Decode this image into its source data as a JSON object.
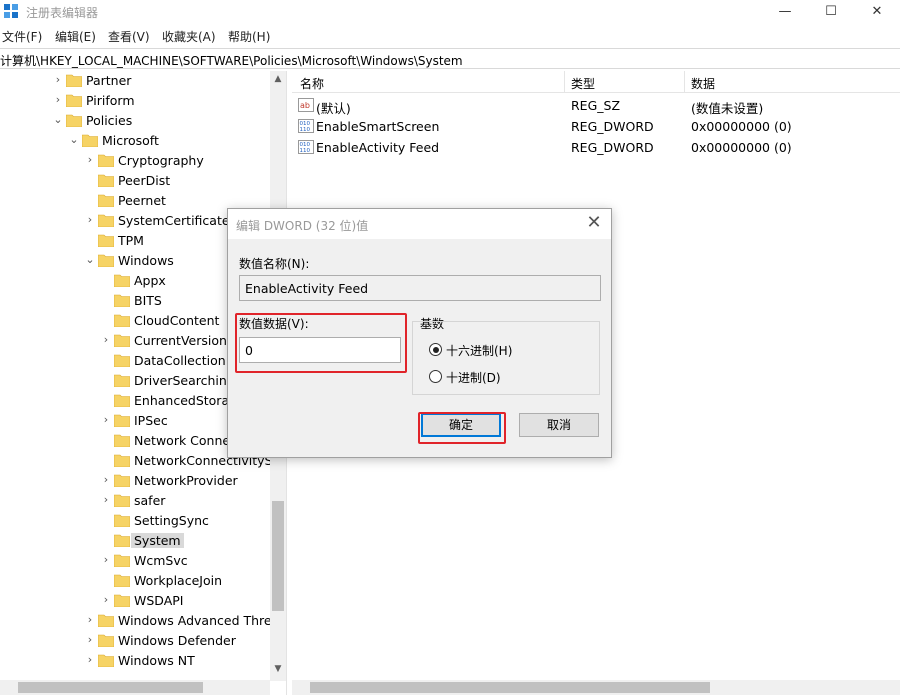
{
  "window": {
    "title": "注册表编辑器",
    "controls": {
      "minimize": "—",
      "maximize": "☐",
      "close": "✕"
    }
  },
  "menu": [
    "文件(F)",
    "编辑(E)",
    "查看(V)",
    "收藏夹(A)",
    "帮助(H)"
  ],
  "address": "计算机\\HKEY_LOCAL_MACHINE\\SOFTWARE\\Policies\\Microsoft\\Windows\\System",
  "tree": {
    "items": [
      {
        "label": "Partner",
        "expander": "›"
      },
      {
        "label": "Piriform",
        "expander": "›"
      },
      {
        "label": "Policies",
        "expander": "⌄"
      },
      {
        "label": "Microsoft",
        "expander": "⌄"
      },
      {
        "label": "Cryptography",
        "expander": "›"
      },
      {
        "label": "PeerDist",
        "expander": ""
      },
      {
        "label": "Peernet",
        "expander": ""
      },
      {
        "label": "SystemCertificates",
        "expander": "›"
      },
      {
        "label": "TPM",
        "expander": ""
      },
      {
        "label": "Windows",
        "expander": "⌄"
      },
      {
        "label": "Appx",
        "expander": ""
      },
      {
        "label": "BITS",
        "expander": ""
      },
      {
        "label": "CloudContent",
        "expander": ""
      },
      {
        "label": "CurrentVersion",
        "expander": "›"
      },
      {
        "label": "DataCollection",
        "expander": ""
      },
      {
        "label": "DriverSearching",
        "expander": ""
      },
      {
        "label": "EnhancedStorag",
        "expander": ""
      },
      {
        "label": "IPSec",
        "expander": "›"
      },
      {
        "label": "Network Connec",
        "expander": ""
      },
      {
        "label": "NetworkConnectivitySta",
        "expander": ""
      },
      {
        "label": "NetworkProvider",
        "expander": "›"
      },
      {
        "label": "safer",
        "expander": "›"
      },
      {
        "label": "SettingSync",
        "expander": ""
      },
      {
        "label": "System",
        "expander": ""
      },
      {
        "label": "WcmSvc",
        "expander": "›"
      },
      {
        "label": "WorkplaceJoin",
        "expander": ""
      },
      {
        "label": "WSDAPI",
        "expander": "›"
      },
      {
        "label": "Windows Advanced Threa",
        "expander": "›"
      },
      {
        "label": "Windows Defender",
        "expander": "›"
      },
      {
        "label": "Windows NT",
        "expander": "›"
      }
    ]
  },
  "list": {
    "headers": {
      "name": "名称",
      "type": "类型",
      "data": "数据"
    },
    "rows": [
      {
        "name": "(默认)",
        "type": "REG_SZ",
        "data": "(数值未设置)",
        "icon": "string-value-icon"
      },
      {
        "name": "EnableSmartScreen",
        "type": "REG_DWORD",
        "data": "0x00000000 (0)",
        "icon": "binary-value-icon"
      },
      {
        "name": "EnableActivity Feed",
        "type": "REG_DWORD",
        "data": "0x00000000 (0)",
        "icon": "binary-value-icon"
      }
    ]
  },
  "dialog": {
    "title": "编辑 DWORD (32 位)值",
    "close": "✕",
    "name_label": "数值名称(N):",
    "name_value": "EnableActivity Feed",
    "data_label": "数值数据(V):",
    "data_value": "0",
    "base_label": "基数",
    "hex_label": "十六进制(H)",
    "dec_label": "十进制(D)",
    "base_selected": "hex",
    "ok": "确定",
    "cancel": "取消"
  },
  "colors": {
    "highlight": "#e0242a",
    "folder": "#f6d365",
    "accent": "#0078d7"
  }
}
